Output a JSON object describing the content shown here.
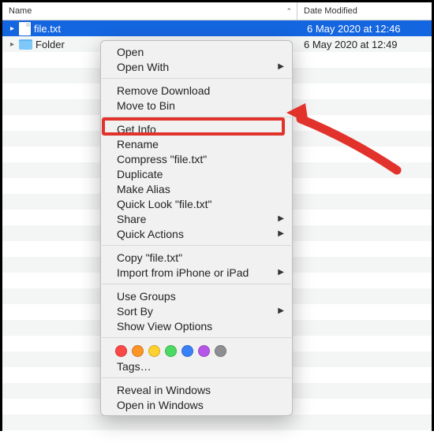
{
  "header": {
    "name_label": "Name",
    "date_label": "Date Modified",
    "sort_glyph": "⌃"
  },
  "rows": [
    {
      "type": "file",
      "name": "file.txt",
      "date": "6 May 2020 at 12:46",
      "selected": true
    },
    {
      "type": "folder",
      "name": "Folder",
      "date": "6 May 2020 at 12:49",
      "selected": false
    }
  ],
  "menu": {
    "groups": [
      [
        {
          "label": "Open",
          "submenu": false
        },
        {
          "label": "Open With",
          "submenu": true
        }
      ],
      [
        {
          "label": "Remove Download",
          "submenu": false
        },
        {
          "label": "Move to Bin",
          "submenu": false
        }
      ],
      [
        {
          "label": "Get Info",
          "submenu": false,
          "highlight": true
        },
        {
          "label": "Rename",
          "submenu": false
        },
        {
          "label": "Compress \"file.txt\"",
          "submenu": false
        },
        {
          "label": "Duplicate",
          "submenu": false
        },
        {
          "label": "Make Alias",
          "submenu": false
        },
        {
          "label": "Quick Look \"file.txt\"",
          "submenu": false
        },
        {
          "label": "Share",
          "submenu": true
        },
        {
          "label": "Quick Actions",
          "submenu": true
        }
      ],
      [
        {
          "label": "Copy \"file.txt\"",
          "submenu": false
        },
        {
          "label": "Import from iPhone or iPad",
          "submenu": true
        }
      ],
      [
        {
          "label": "Use Groups",
          "submenu": false
        },
        {
          "label": "Sort By",
          "submenu": true
        },
        {
          "label": "Show View Options",
          "submenu": false
        }
      ]
    ],
    "tags_colors": [
      "#fb4945",
      "#fd9526",
      "#fdd230",
      "#4cd964",
      "#3a80f6",
      "#b656e8",
      "#8e8e93"
    ],
    "tags_label": "Tags…",
    "last_group": [
      {
        "label": "Reveal in Windows",
        "submenu": false
      },
      {
        "label": "Open in Windows",
        "submenu": false
      }
    ]
  }
}
